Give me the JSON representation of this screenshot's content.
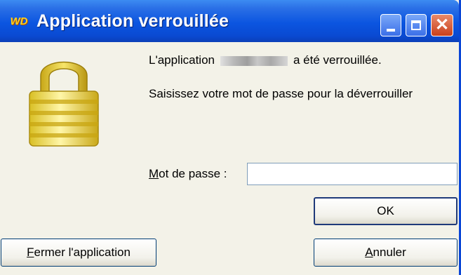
{
  "window": {
    "logo_text": "WD",
    "title": "Application verrouillée",
    "controls": {
      "minimize_icon": "minimize-icon",
      "maximize_icon": "maximize-icon",
      "close_icon": "close-icon"
    }
  },
  "dialog": {
    "icon": "padlock-icon",
    "message_before": "L'application",
    "message_after": "a été verrouillée.",
    "instruction": "Saisissez votre mot de passe pour la déverrouiller",
    "password_label_accel": "M",
    "password_label_rest": "ot de passe :",
    "password_value": "",
    "ok_label": "OK",
    "close_app_accel": "F",
    "close_app_rest": "ermer l'application",
    "cancel_accel": "A",
    "cancel_rest": "nnuler"
  },
  "colors": {
    "titlebar": "#0b55e0",
    "lock_gold": "#f2dc3a"
  }
}
